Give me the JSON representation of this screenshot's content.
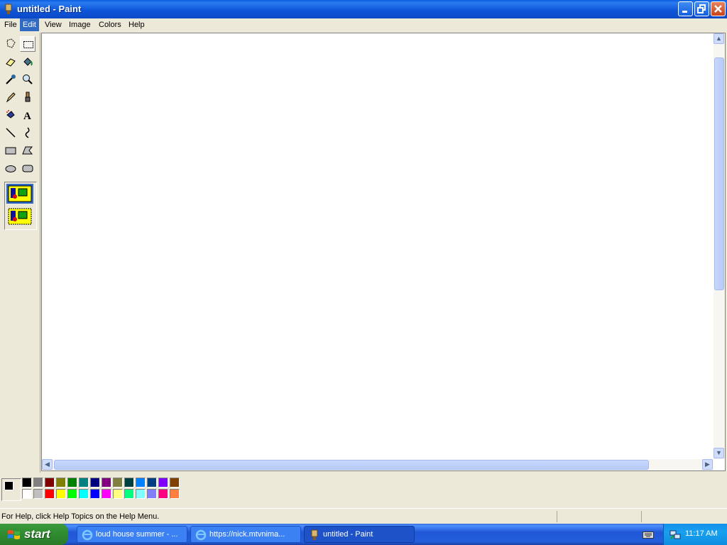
{
  "window": {
    "title": "untitled - Paint"
  },
  "menu": [
    "File",
    "Edit",
    "View",
    "Image",
    "Colors",
    "Help"
  ],
  "menu_active": "Edit",
  "tools": [
    "free-form-select",
    "select",
    "eraser",
    "fill-with-color",
    "pick-color",
    "magnifier",
    "pencil",
    "brush",
    "airbrush",
    "text",
    "line",
    "curve",
    "rectangle",
    "polygon",
    "ellipse",
    "rounded-rectangle"
  ],
  "selected_tool": "select",
  "colors": {
    "foreground": "#000000",
    "background": "#FFFFFF",
    "palette_top": [
      "#000000",
      "#808080",
      "#800000",
      "#808000",
      "#008000",
      "#008080",
      "#000080",
      "#800080",
      "#808040",
      "#004040",
      "#0080FF",
      "#004080",
      "#8000FF",
      "#804000"
    ],
    "palette_bottom": [
      "#FFFFFF",
      "#C0C0C0",
      "#FF0000",
      "#FFFF00",
      "#00FF00",
      "#00FFFF",
      "#0000FF",
      "#FF00FF",
      "#FFFF80",
      "#00FF80",
      "#80FFFF",
      "#8080FF",
      "#FF0080",
      "#FF8040"
    ]
  },
  "status": {
    "text": "For Help, click Help Topics on the Help Menu."
  },
  "taskbar": {
    "start_label": "start",
    "tasks": [
      {
        "label": "loud house summer - ...",
        "icon": "ie-icon"
      },
      {
        "label": "https://nick.mtvnima...",
        "icon": "ie-icon"
      },
      {
        "label": "untitled - Paint",
        "icon": "paint-icon",
        "active": true
      }
    ],
    "clock": "11:17 AM"
  }
}
